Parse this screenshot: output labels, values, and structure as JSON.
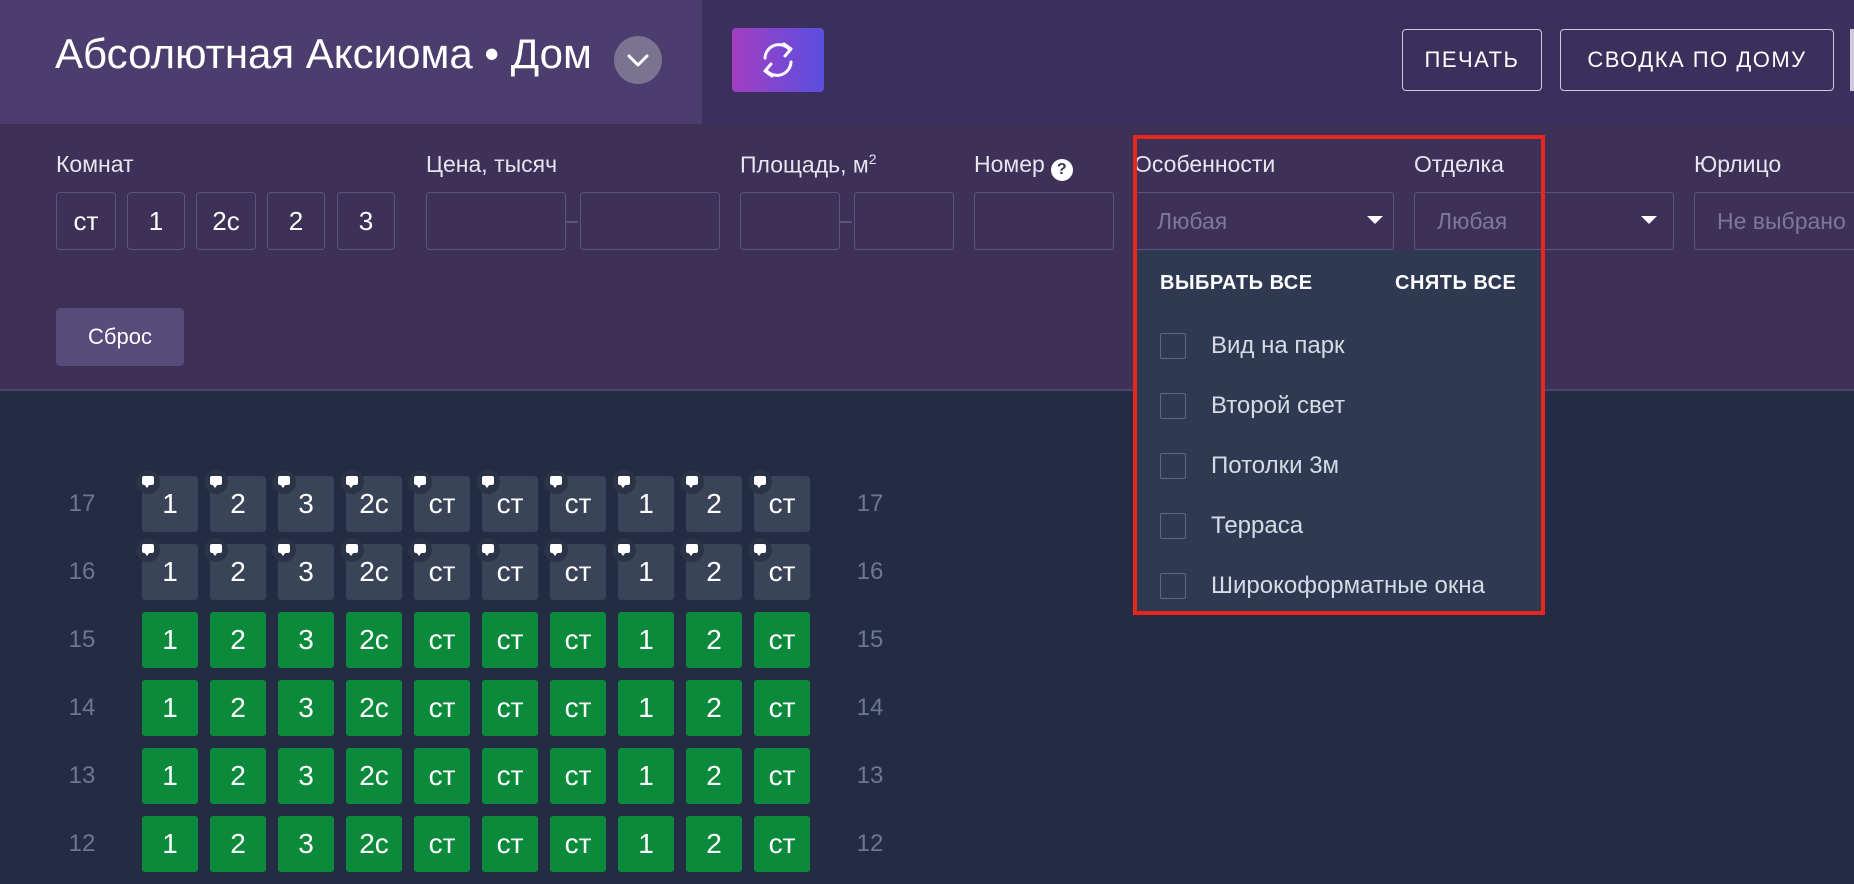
{
  "header": {
    "title": "Абсолютная Аксиома • Дом",
    "print_label": "ПЕЧАТЬ",
    "summary_label": "СВОДКА ПО ДОМУ"
  },
  "filters": {
    "rooms_label": "Комнат",
    "rooms_options": [
      "ст",
      "1",
      "2с",
      "2",
      "3"
    ],
    "price_label": "Цена, тысяч",
    "area_label": "Площадь, м",
    "area_sup": "2",
    "number_label": "Номер",
    "features_label": "Особенности",
    "features_placeholder": "Любая",
    "finish_label": "Отделка",
    "finish_placeholder": "Любая",
    "legal_label": "Юрлицо",
    "legal_placeholder": "Не выбрано",
    "reset_label": "Сброс"
  },
  "dropdown": {
    "select_all": "ВЫБРАТЬ ВСЕ",
    "clear_all": "СНЯТЬ ВСЕ",
    "items": [
      "Вид на парк",
      "Второй свет",
      "Потолки 3м",
      "Терраса",
      "Широкоформатные окна"
    ]
  },
  "grid": {
    "floors": [
      {
        "floor": "17",
        "status": "gray",
        "comments": true
      },
      {
        "floor": "16",
        "status": "gray",
        "comments": true
      },
      {
        "floor": "15",
        "status": "green",
        "comments": false
      },
      {
        "floor": "14",
        "status": "green",
        "comments": false
      },
      {
        "floor": "13",
        "status": "green",
        "comments": false
      },
      {
        "floor": "12",
        "status": "green",
        "comments": false
      }
    ],
    "units": [
      "1",
      "2",
      "3",
      "2с",
      "ст",
      "ст",
      "ст",
      "1",
      "2",
      "ст"
    ],
    "colors": {
      "gray": "#3a4459",
      "green": "#0a8a3a"
    }
  }
}
